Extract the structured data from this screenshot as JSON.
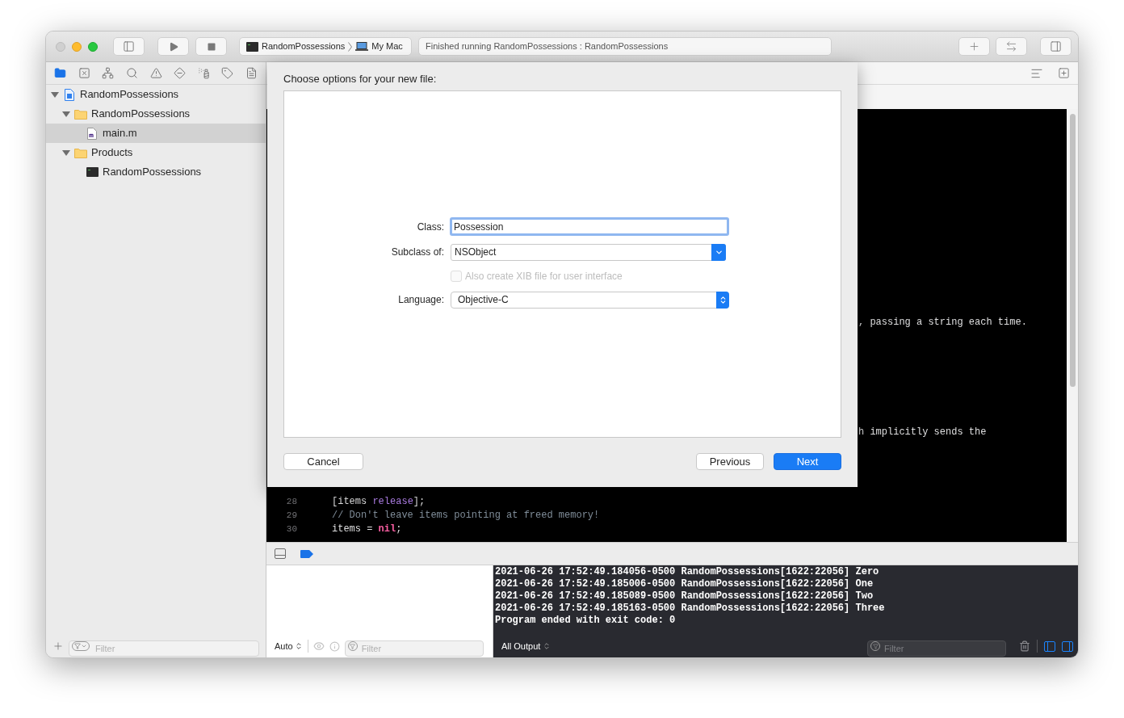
{
  "toolbar": {
    "scheme": "RandomPossessions",
    "destination": "My Mac",
    "status": "Finished running RandomPossessions : RandomPossessions"
  },
  "navigator": {
    "tabs": [
      {
        "kind": "folder",
        "selected": true
      },
      {
        "kind": "xbox",
        "selected": false
      },
      {
        "kind": "hierarchy",
        "selected": false
      },
      {
        "kind": "search",
        "selected": false
      },
      {
        "kind": "warning",
        "selected": false
      },
      {
        "kind": "diamond",
        "selected": false
      },
      {
        "kind": "spray",
        "selected": false
      },
      {
        "kind": "tag",
        "selected": false
      },
      {
        "kind": "list",
        "selected": false
      }
    ],
    "tree": [
      {
        "label": "RandomPossessions",
        "kind": "project",
        "expanded": true,
        "selected": false,
        "children": [
          {
            "label": "RandomPossessions",
            "kind": "folder",
            "expanded": true,
            "selected": false,
            "children": [
              {
                "label": "main.m",
                "kind": "source",
                "selected": true
              }
            ]
          },
          {
            "label": "Products",
            "kind": "folder",
            "expanded": true,
            "selected": false,
            "children": [
              {
                "label": "RandomPossessions",
                "kind": "app",
                "selected": false
              }
            ]
          }
        ]
      }
    ],
    "filter": {
      "placeholder": "Filter"
    }
  },
  "editor": {
    "fragments": [
      ", passing a string each time.",
      "h implicitly sends the"
    ],
    "lines": [
      {
        "number": "28",
        "tokens": [
          {
            "kind": "plain",
            "text": "[items "
          },
          {
            "kind": "method",
            "text": "release"
          },
          {
            "kind": "plain",
            "text": "];"
          }
        ]
      },
      {
        "number": "29",
        "tokens": [
          {
            "kind": "comment",
            "text": "// Don't leave items pointing at freed memory!"
          }
        ]
      },
      {
        "number": "30",
        "tokens": [
          {
            "kind": "plain",
            "text": "items = "
          },
          {
            "kind": "keyword",
            "text": "nil"
          },
          {
            "kind": "plain",
            "text": ";"
          }
        ]
      }
    ]
  },
  "sheet": {
    "title": "Choose options for your new file:",
    "class": {
      "label": "Class:",
      "value": "Possession"
    },
    "subclass": {
      "label": "Subclass of:",
      "value": "NSObject"
    },
    "xib": {
      "label": "Also create XIB file for user interface",
      "checked": false,
      "disabled": true
    },
    "language": {
      "label": "Language:",
      "value": "Objective-C"
    },
    "buttons": [
      {
        "label": "Cancel",
        "kind": "cancel"
      },
      {
        "label": "Previous",
        "kind": "normal"
      },
      {
        "label": "Next",
        "kind": "default"
      }
    ]
  },
  "debug": {
    "variables": {
      "scope": "Auto",
      "filter": {
        "placeholder": "Filter"
      }
    },
    "console": {
      "lines": [
        "2021-06-26 17:52:49.184056-0500 RandomPossessions[1622:22056] Zero",
        "2021-06-26 17:52:49.185006-0500 RandomPossessions[1622:22056] One",
        "2021-06-26 17:52:49.185089-0500 RandomPossessions[1622:22056] Two",
        "2021-06-26 17:52:49.185163-0500 RandomPossessions[1622:22056] Three",
        "Program ended with exit code: 0"
      ],
      "output": "All Output",
      "filter": {
        "placeholder": "Filter"
      },
      "panes": [
        {
          "selected": true
        },
        {
          "selected": true
        }
      ]
    }
  }
}
